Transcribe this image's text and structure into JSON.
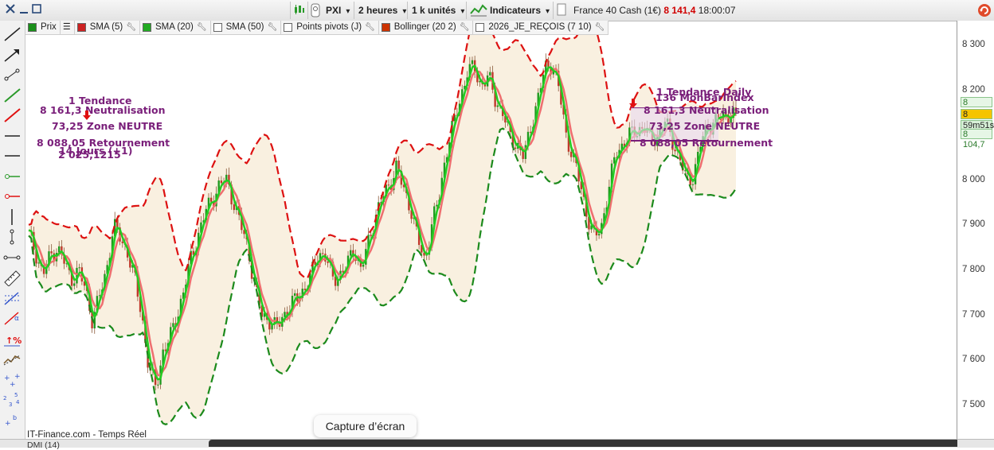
{
  "toolbar": {
    "instrument_selector": "PXI",
    "period_selector": "2 heures",
    "units_selector": "1 k unités",
    "indicators_label": "Indicateurs",
    "instrument_name": "France 40 Cash (1€)",
    "last_price": "8 141,4",
    "time": "18:00:07",
    "icons": [
      "close-icon",
      "minus-icon",
      "maximize-icon",
      "candlestick-icon",
      "pin-icon",
      "indicators-chart-icon",
      "refresh-icon"
    ]
  },
  "indicators": [
    {
      "label": "Prix",
      "color": "#1a8f1a"
    },
    {
      "label": "",
      "icon": "list-icon"
    },
    {
      "label": "SMA (5)",
      "color": "#cc2222"
    },
    {
      "label": "SMA (20)",
      "color": "#22aa22"
    },
    {
      "label": "SMA (50)",
      "color": "#ffffff"
    },
    {
      "label": "Points pivots (J)",
      "color": "#ffffff"
    },
    {
      "label": "Bollinger (20 2)",
      "color": "#cc3300"
    },
    {
      "label": "2026_JE_REÇOIS (7 10)",
      "color": "#ffffff"
    }
  ],
  "left_tools": [
    "line-tool-icon",
    "arrow-tool-icon",
    "segment-tool-icon",
    "green-trend-icon",
    "red-trend-icon",
    "horizontal-line-icon",
    "horizontal-ray-icon",
    "green-ray-icon",
    "red-ray-icon",
    "vertical-line-icon",
    "vertical-segment-icon",
    "channel-icon",
    "ruler-icon",
    "fibonacci-icon",
    "alpha-icon",
    "percent-icon",
    "wave-icon",
    "elliott-icon",
    "numbered-waves-icon",
    "ab-waves-icon"
  ],
  "y_axis": {
    "ticks": [
      "8 300",
      "8 200",
      "8 100",
      "8 000",
      "7 900",
      "7 800",
      "7 700",
      "7 600",
      "7 500"
    ],
    "boxes": [
      {
        "label": "8 176,1",
        "bg": "#e6f6e6",
        "fg": "#2a7a2a"
      },
      {
        "label": "8 141,4",
        "bg": "#f5c400",
        "fg": "#222222"
      },
      {
        "label": "59m51s",
        "bg": "#d8f0d8",
        "fg": "#222222"
      },
      {
        "label": "8 104,7",
        "bg": "#e6f6e6",
        "fg": "#2a7a2a"
      }
    ]
  },
  "annotations_left": {
    "line1": "1  Tendance",
    "line2": "8 161,3  Neutralisation",
    "line3": "73,25  Zone NEUTRE",
    "line4": "8 088,05  Retournement",
    "line5": "14  Jours (+1)",
    "line6": "2 025,1215"
  },
  "annotations_right": {
    "line1": "1  Tendance Daily",
    "line2": "136  MonBarIndex",
    "line3": "8 161,3  Neutralisation",
    "line4": "73,25  Zone NEUTRE",
    "line5": "8 088,05  Retournement"
  },
  "source_label": "IT-Finance.com - Temps Réel",
  "bottom_panel": "DMI (14)",
  "capture_tooltip": "Capture d’écran",
  "chart_data": {
    "type": "candlestick",
    "ylim": [
      7450,
      8330
    ],
    "close_path": [
      7880,
      7840,
      7790,
      7830,
      7850,
      7820,
      7780,
      7800,
      7760,
      7690,
      7740,
      7800,
      7900,
      7870,
      7840,
      7780,
      7700,
      7580,
      7540,
      7620,
      7650,
      7700,
      7760,
      7830,
      7880,
      7930,
      7960,
      7990,
      8000,
      7950,
      7900,
      7850,
      7760,
      7700,
      7690,
      7670,
      7700,
      7720,
      7740,
      7760,
      7790,
      7840,
      7830,
      7780,
      7790,
      7810,
      7850,
      7800,
      7860,
      7920,
      7960,
      7990,
      8030,
      7980,
      7940,
      7870,
      7820,
      7900,
      7960,
      8060,
      8120,
      8180,
      8240,
      8250,
      8210,
      8230,
      8180,
      8150,
      8100,
      8080,
      8050,
      8120,
      8180,
      8250,
      8260,
      8200,
      8100,
      8050,
      7990,
      7920,
      7870,
      7900,
      7980,
      8060,
      8080,
      8100,
      8110,
      8120,
      8090,
      8100,
      8130,
      8090,
      8050,
      8000,
      8010,
      8080,
      8120,
      8130,
      8140,
      8150,
      8141
    ]
  }
}
